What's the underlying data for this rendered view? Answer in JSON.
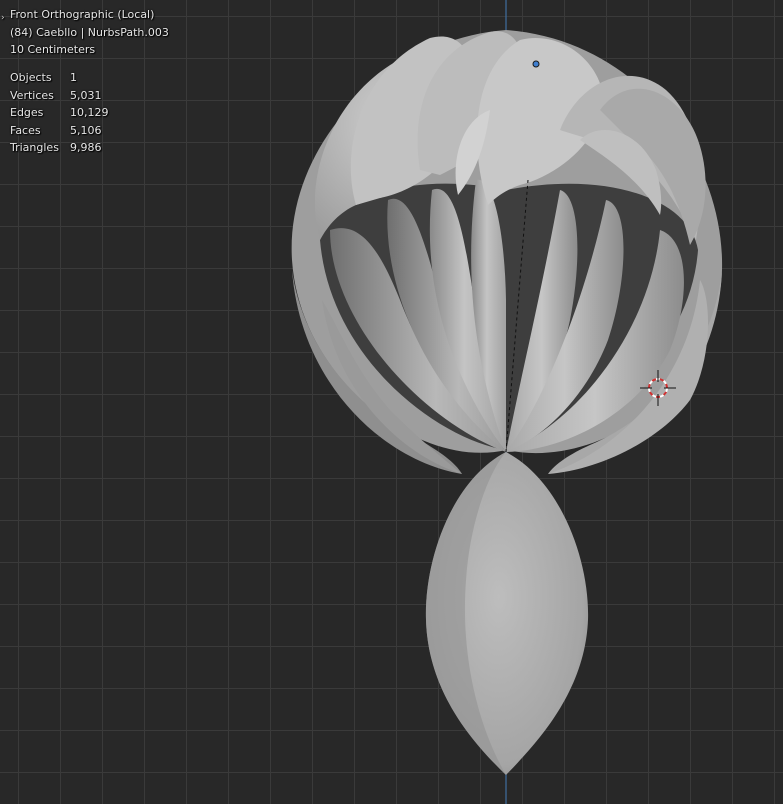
{
  "header": {
    "view_name": "Front Orthographic (Local)",
    "object_info": "(84) Caebllo | NurbsPath.003",
    "scale": "10 Centimeters"
  },
  "stats": [
    {
      "label": "Objects",
      "value": "1"
    },
    {
      "label": "Vertices",
      "value": "5,031"
    },
    {
      "label": "Edges",
      "value": "10,129"
    },
    {
      "label": "Faces",
      "value": "5,106"
    },
    {
      "label": "Triangles",
      "value": "9,986"
    }
  ],
  "colors": {
    "background": "#282828",
    "grid": "#3a3a3a",
    "z_axis": "#3f6fa0",
    "mesh": "#b4b4b4",
    "cursor_red": "#d23030"
  }
}
